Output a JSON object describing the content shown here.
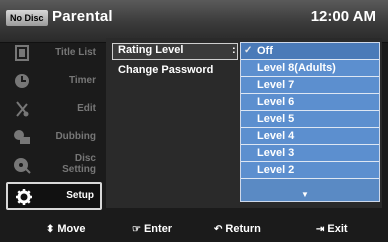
{
  "header": {
    "badge": "No Disc",
    "title": "Parental",
    "clock": "12:00 AM"
  },
  "nav": {
    "items": [
      {
        "label": "Title List",
        "icon": "film-icon",
        "active": false
      },
      {
        "label": "Timer",
        "icon": "timer-icon",
        "active": false
      },
      {
        "label": "Edit",
        "icon": "scissors-icon",
        "active": false
      },
      {
        "label": "Dubbing",
        "icon": "dubbing-icon",
        "active": false
      },
      {
        "label": "Disc",
        "label2": "Setting",
        "icon": "disc-icon",
        "active": false
      },
      {
        "label": "Setup",
        "icon": "gear-icon",
        "active": true
      }
    ]
  },
  "panel": {
    "rows": [
      {
        "label": "Rating Level",
        "selected": true
      },
      {
        "label": "Change Password",
        "selected": false
      }
    ],
    "colon": ":"
  },
  "dropdown": {
    "items": [
      "Off",
      "Level 8(Adults)",
      "Level 7",
      "Level 6",
      "Level 5",
      "Level 4",
      "Level 3",
      "Level 2"
    ],
    "checked_index": 0,
    "check_mark": "✓",
    "more_indicator": "▼"
  },
  "footer": {
    "move": "Move",
    "enter": "Enter",
    "return": "Return",
    "exit": "Exit"
  },
  "colors": {
    "dropdown_bg": "#5c8fcf",
    "highlight_border": "#d8d8d8"
  }
}
